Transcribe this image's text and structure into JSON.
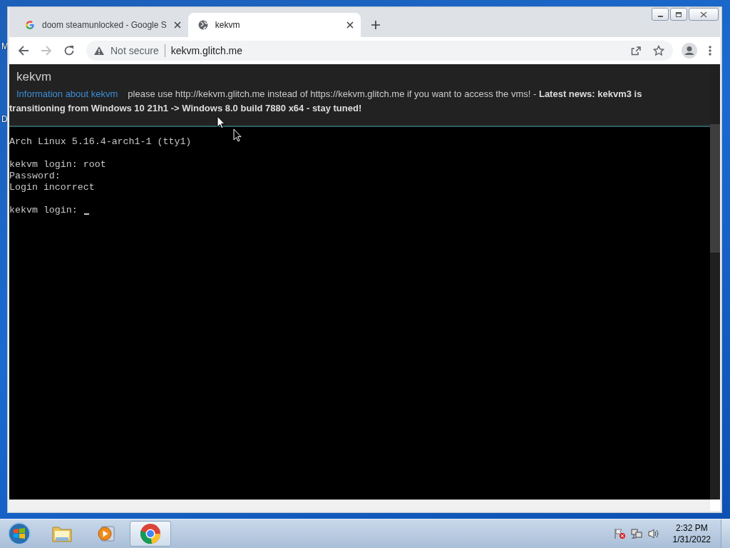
{
  "desktop_labels": [
    "M",
    "D"
  ],
  "browser": {
    "tabs": [
      {
        "title": "doom steamunlocked - Google S",
        "selected": false
      },
      {
        "title": "kekvm",
        "selected": true
      }
    ],
    "toolbar": {
      "back_enabled": true,
      "forward_enabled": false,
      "security": "Not secure",
      "url": "kekvm.glitch.me"
    }
  },
  "page": {
    "title": "kekvm",
    "info_link": "Information about kekvm",
    "notice": "please use http://kekvm.glitch.me instead of https://kekvm.glitch.me if you want to access the vms! - **Latest news: kekvm3 is transitioning from Windows 10 21h1 -> Windows 8.0 build 7880 x64 - stay tuned!**",
    "terminal": {
      "blocks": [
        [
          "Arch Linux 5.16.4-arch1-1 (tty1)"
        ],
        [
          "kekvm login: root",
          "Password:",
          "Login incorrect"
        ],
        [
          "kekvm login:"
        ]
      ],
      "cursor": true
    }
  },
  "taskbar": {
    "apps": [
      {
        "kind": "explorer",
        "selected": false
      },
      {
        "kind": "media",
        "selected": false
      },
      {
        "kind": "chrome",
        "selected": true
      }
    ],
    "time": "2:32 PM",
    "date": "1/31/2022"
  }
}
